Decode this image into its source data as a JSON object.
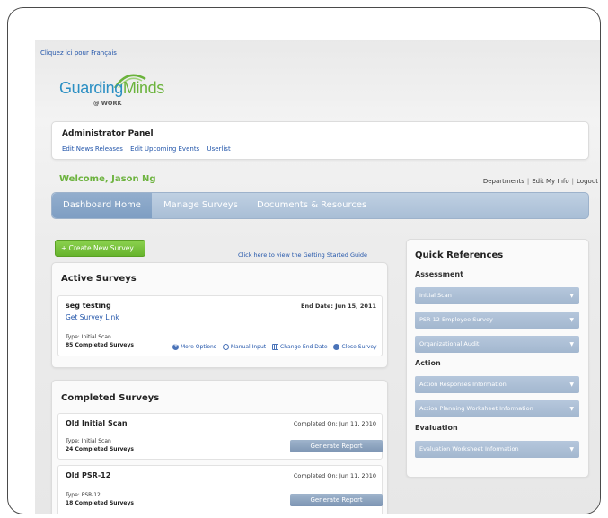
{
  "language_link": "Cliquez ici pour Français",
  "logo": {
    "part1": "Guarding",
    "part2": "Minds",
    "sub": "@ WORK"
  },
  "admin": {
    "title": "Administrator Panel",
    "links": [
      "Edit News Releases",
      "Edit Upcoming Events",
      "Userlist"
    ]
  },
  "welcome": "Welcome, Jason Ng",
  "user_links": [
    "Departments",
    "Edit My Info",
    "Logout"
  ],
  "nav": {
    "tabs": [
      "Dashboard Home",
      "Manage Surveys",
      "Documents & Resources"
    ],
    "active": "Dashboard Home"
  },
  "create_button": "+ Create New Survey",
  "guide_link": "Click here to view the Getting Started Guide",
  "active_surveys": {
    "title": "Active Surveys",
    "items": [
      {
        "name": "seg testing",
        "end_date": "End Date: Jun 15, 2011",
        "link": "Get Survey Link",
        "type": "Type: Initial Scan",
        "count": "85 Completed Surveys",
        "actions": [
          "More Options",
          "Manual Input",
          "Change End Date",
          "Close Survey"
        ]
      }
    ]
  },
  "completed_surveys": {
    "title": "Completed Surveys",
    "items": [
      {
        "name": "Old Initial Scan",
        "completed": "Completed On: Jun 11, 2010",
        "type": "Type: Initial Scan",
        "count": "24 Completed Surveys",
        "button": "Generate Report"
      },
      {
        "name": "Old PSR-12",
        "completed": "Completed On: Jun 11, 2010",
        "type": "Type: PSR-12",
        "count": "18 Completed Surveys",
        "button": "Generate Report"
      }
    ]
  },
  "quick_refs": {
    "title": "Quick References",
    "sections": [
      {
        "heading": "Assessment",
        "items": [
          "Initial Scan",
          "PSR-12 Employee Survey",
          "Organizational Audit"
        ]
      },
      {
        "heading": "Action",
        "items": [
          "Action Responses Information",
          "Action Planning Worksheet Information"
        ]
      },
      {
        "heading": "Evaluation",
        "items": [
          "Evaluation Worksheet Information"
        ]
      }
    ],
    "chevron": "▼"
  },
  "colors": {
    "brand_green": "#6db33f",
    "brand_blue": "#2b8fc3",
    "nav": "#a9bed6",
    "link": "#2255aa"
  }
}
